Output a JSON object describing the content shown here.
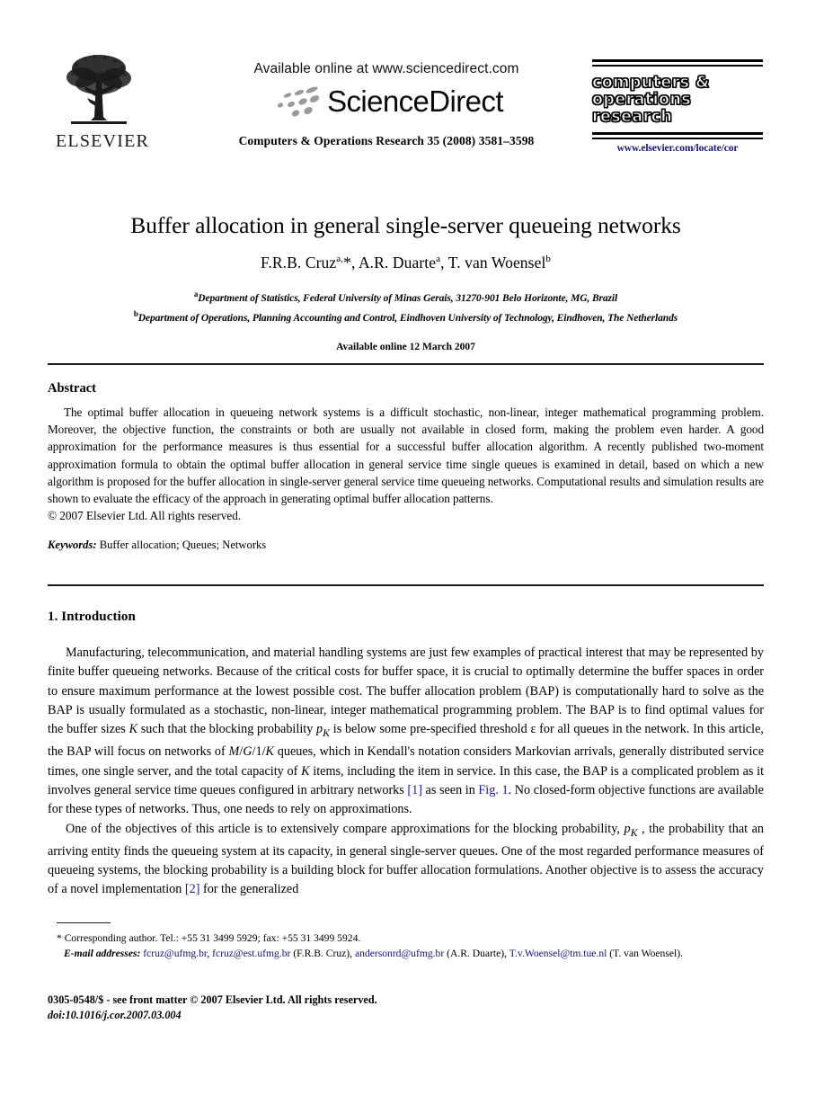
{
  "masthead": {
    "publisher_name": "ELSEVIER",
    "publisher_logo_icon": "elsevier-tree-icon",
    "available_online": "Available online at www.sciencedirect.com",
    "sciencedirect_wordmark": "ScienceDirect",
    "sciencedirect_swoosh_icon": "sciencedirect-swoosh-icon",
    "citation": "Computers & Operations Research 35 (2008) 3581–3598",
    "journal_title_line1": "computers &",
    "journal_title_line2": "operations",
    "journal_title_line3": "research",
    "journal_url": "www.elsevier.com/locate/cor"
  },
  "title_block": {
    "title": "Buffer allocation in general single-server queueing networks",
    "authors_html": "F.R.B. Cruz<sup>a,</sup>*, A.R. Duarte<sup>a</sup>, T. van Woensel<sup>b</sup>",
    "affiliation_a": "Department of Statistics, Federal University of Minas Gerais, 31270-901 Belo Horizonte, MG, Brazil",
    "affiliation_b": "Department of Operations, Planning Accounting and Control, Eindhoven University of Technology, Eindhoven, The Netherlands",
    "affil_a_marker": "a",
    "affil_b_marker": "b",
    "available_online_date": "Available online 12 March 2007"
  },
  "abstract": {
    "heading": "Abstract",
    "body": "The optimal buffer allocation in queueing network systems is a difficult stochastic, non-linear, integer mathematical programming problem. Moreover, the objective function, the constraints or both are usually not available in closed form, making the problem even harder. A good approximation for the performance measures is thus essential for a successful buffer allocation algorithm. A recently published two-moment approximation formula to obtain the optimal buffer allocation in general service time single queues is examined in detail, based on which a new algorithm is proposed for the buffer allocation in single-server general service time queueing networks. Computational results and simulation results are shown to evaluate the efficacy of the approach in generating optimal buffer allocation patterns.",
    "copyright": "© 2007 Elsevier Ltd. All rights reserved.",
    "keywords_label": "Keywords:",
    "keywords_value": "Buffer allocation; Queues; Networks"
  },
  "introduction": {
    "heading": "1.  Introduction",
    "paragraph1_html": "Manufacturing, telecommunication, and material handling systems are just few examples of practical interest that may be represented by finite buffer queueing networks. Because of the critical costs for buffer space, it is crucial to optimally determine the buffer spaces in order to ensure maximum performance at the lowest possible cost. The buffer allocation problem (BAP) is computationally hard to solve as the BAP is usually formulated as a stochastic, non-linear, integer mathematical programming problem. The BAP is to find optimal values for the buffer sizes <i>K</i> such that the blocking probability <i>p<sub>K</sub></i> is below some pre-specified threshold &#949; for all queues in the network. In this article, the BAP will focus on networks of <i>M</i>/<i>G</i>/1/<i>K</i> queues, which in Kendall's notation considers Markovian arrivals, generally distributed service times, one single server, and the total capacity of <i>K</i> items, including the item in service. In this case, the BAP is a complicated problem as it involves general service time queues configured in arbitrary networks <span class=\"lnk\">[1]</span> as seen in <span class=\"lnk\">Fig. 1</span>. No closed-form objective functions are available for these types of networks. Thus, one needs to rely on approximations.",
    "paragraph2_html": "One of the objectives of this article is to extensively compare approximations for the blocking probability, <i>p<sub>K</sub></i> , the probability that an arriving entity finds the queueing system at its capacity, in general single-server queues. One of the most regarded performance measures of queueing systems, the blocking probability is a building block for buffer allocation formulations. Another objective is to assess the accuracy of a novel implementation <span class=\"lnk\">[2]</span> for the generalized"
  },
  "footnotes": {
    "corresponding": "* Corresponding author. Tel.: +55 31 3499 5929; fax: +55 31 3499 5924.",
    "email_label": "E-mail addresses:",
    "email_1": "fcruz@ufmg.br",
    "email_2": "fcruz@est.ufmg.br",
    "email_1_attrib": "(F.R.B. Cruz),",
    "email_3": "andersonrd@ufmg.br",
    "email_3_attrib": "(A.R. Duarte),",
    "email_4": "T.v.Woensel@tm.tue.nl",
    "email_4_attrib": "(T. van Woensel)."
  },
  "bottom_matter": {
    "issn_line": "0305-0548/$ - see front matter © 2007 Elsevier Ltd. All rights reserved.",
    "doi_line": "doi:10.1016/j.cor.2007.03.004"
  },
  "colors": {
    "link": "#1a1aa8",
    "email": "#141478",
    "journal_url": "#141478",
    "text": "#000000",
    "background": "#ffffff"
  }
}
